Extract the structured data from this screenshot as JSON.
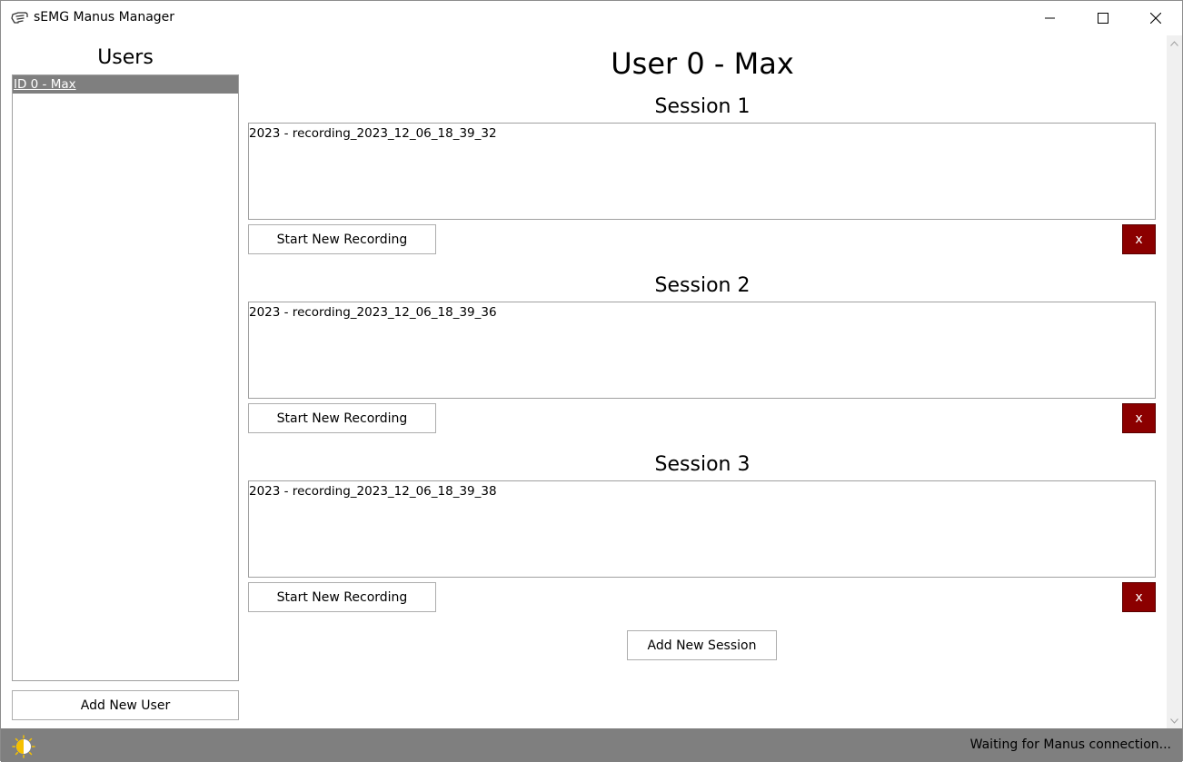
{
  "window": {
    "title": "sEMG Manus Manager",
    "app_icon": "hand-icon",
    "controls": {
      "minimize": "minimize-icon",
      "maximize": "maximize-icon",
      "close": "close-icon"
    }
  },
  "users_panel": {
    "heading": "Users",
    "items": [
      {
        "label": "ID 0 - Max",
        "selected": true
      }
    ],
    "add_button": "Add New User"
  },
  "main": {
    "user_title": "User 0 - Max",
    "sessions": [
      {
        "title": "Session 1",
        "recordings": [
          "2023 - recording_2023_12_06_18_39_32"
        ],
        "start_button": "Start New Recording",
        "delete_button": "x"
      },
      {
        "title": "Session 2",
        "recordings": [
          "2023 - recording_2023_12_06_18_39_36"
        ],
        "start_button": "Start New Recording",
        "delete_button": "x"
      },
      {
        "title": "Session 3",
        "recordings": [
          "2023 - recording_2023_12_06_18_39_38"
        ],
        "start_button": "Start New Recording",
        "delete_button": "x"
      }
    ],
    "add_session_button": "Add New Session"
  },
  "status_bar": {
    "icon": "theme-toggle-icon",
    "text": "Waiting for Manus connection..."
  },
  "colors": {
    "selection": "#7f7f7f",
    "delete_button": "#8b0000",
    "status_bar": "#7f7f7f"
  }
}
